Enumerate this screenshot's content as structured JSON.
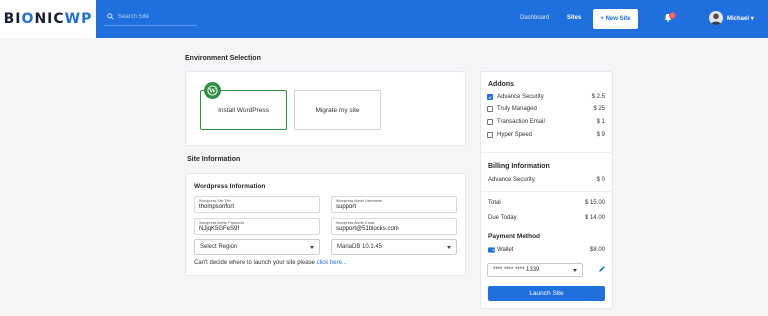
{
  "brand": {
    "logo_pre": "BI",
    "logo_o": "O",
    "logo_post": "NIC",
    "logo_wp": "WP"
  },
  "topbar": {
    "search_placeholder": "Search Site",
    "nav": {
      "dashboard": "Dashboard",
      "sites": "Sites"
    },
    "new_site_label": "+ New Site",
    "notification_count": "0",
    "user_name": "Michael"
  },
  "environment": {
    "heading": "Environment Selection",
    "options": [
      {
        "label": "Install WordPress",
        "selected": true
      },
      {
        "label": "Migrate my site",
        "selected": false
      }
    ]
  },
  "site_info": {
    "heading": "Site Information",
    "subheading": "Wordpress Information",
    "fields": {
      "site_title": {
        "label": "Wordpress Site Title",
        "value": "thompsonfort"
      },
      "admin_username": {
        "label": "Wordpress Admin Username",
        "value": "support"
      },
      "admin_password": {
        "label": "Wordpress Admin Password",
        "value": "NJjqK5GFeS9f"
      },
      "admin_email": {
        "label": "Wordpress Admin Email",
        "value": "support@51blocks.com"
      }
    },
    "region_select": "Select Region",
    "db_select": "MariaDB 10.1.45",
    "hint_text": "Can't decide where to launch your site please ",
    "hint_link": "click here..."
  },
  "addons": {
    "heading": "Addons",
    "items": [
      {
        "label": "Advance Security",
        "price": "$ 2.5",
        "checked": true
      },
      {
        "label": "Truly Managed",
        "price": "$ 25",
        "checked": false
      },
      {
        "label": "Transaction Email",
        "price": "$ 1",
        "checked": false
      },
      {
        "label": "Hyper Speed",
        "price": "$ 9",
        "checked": false
      }
    ]
  },
  "billing": {
    "heading": "Billing Information",
    "advance_security": {
      "label": "Advance Security",
      "value": "$ 0"
    },
    "total": {
      "label": "Total",
      "value": "$ 15.00"
    },
    "due_today": {
      "label": "Due Today",
      "value": "$ 14.00"
    },
    "payment_heading": "Payment Method",
    "wallet": {
      "label": "Wallet",
      "value": "$8.00"
    },
    "card_select": "**** **** **** 1339",
    "launch_label": "Launch Site"
  },
  "colors": {
    "primary": "#1f6fde",
    "wordpress_green": "#2f8f46",
    "badge_red": "#ef4c5e"
  }
}
